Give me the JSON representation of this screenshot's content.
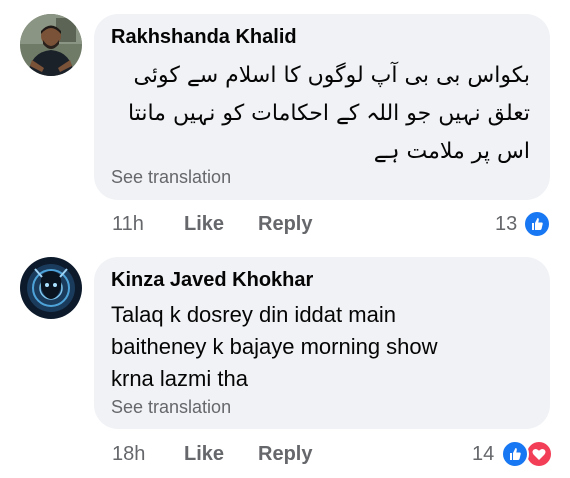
{
  "comments": [
    {
      "author": "Rakhshanda Khalid",
      "lines": [
        "بکواس  بی بی آپ لوگوں کا اسلام سے کوئی",
        "تعلق نہیں جو اللہ کے احکامات کو نہیں مانتا",
        "اس پر ملامت ہے"
      ],
      "see_translation": "See translation",
      "time": "11h",
      "like_label": "Like",
      "reply_label": "Reply",
      "reaction_count": "13",
      "reactions": [
        "like-icon"
      ]
    },
    {
      "author": "Kinza Javed Khokhar",
      "lines": [
        "Talaq k dosrey din iddat main",
        "baitheney k bajaye morning show",
        "krna lazmi tha"
      ],
      "see_translation": "See translation",
      "time": "18h",
      "like_label": "Like",
      "reply_label": "Reply",
      "reaction_count": "14",
      "reactions": [
        "like-icon",
        "love-icon"
      ]
    }
  ],
  "colors": {
    "bubble": "#f0f2f5",
    "secondary_text": "#65676b",
    "like_blue": "#1877f2",
    "love_red": "#f33e58"
  }
}
